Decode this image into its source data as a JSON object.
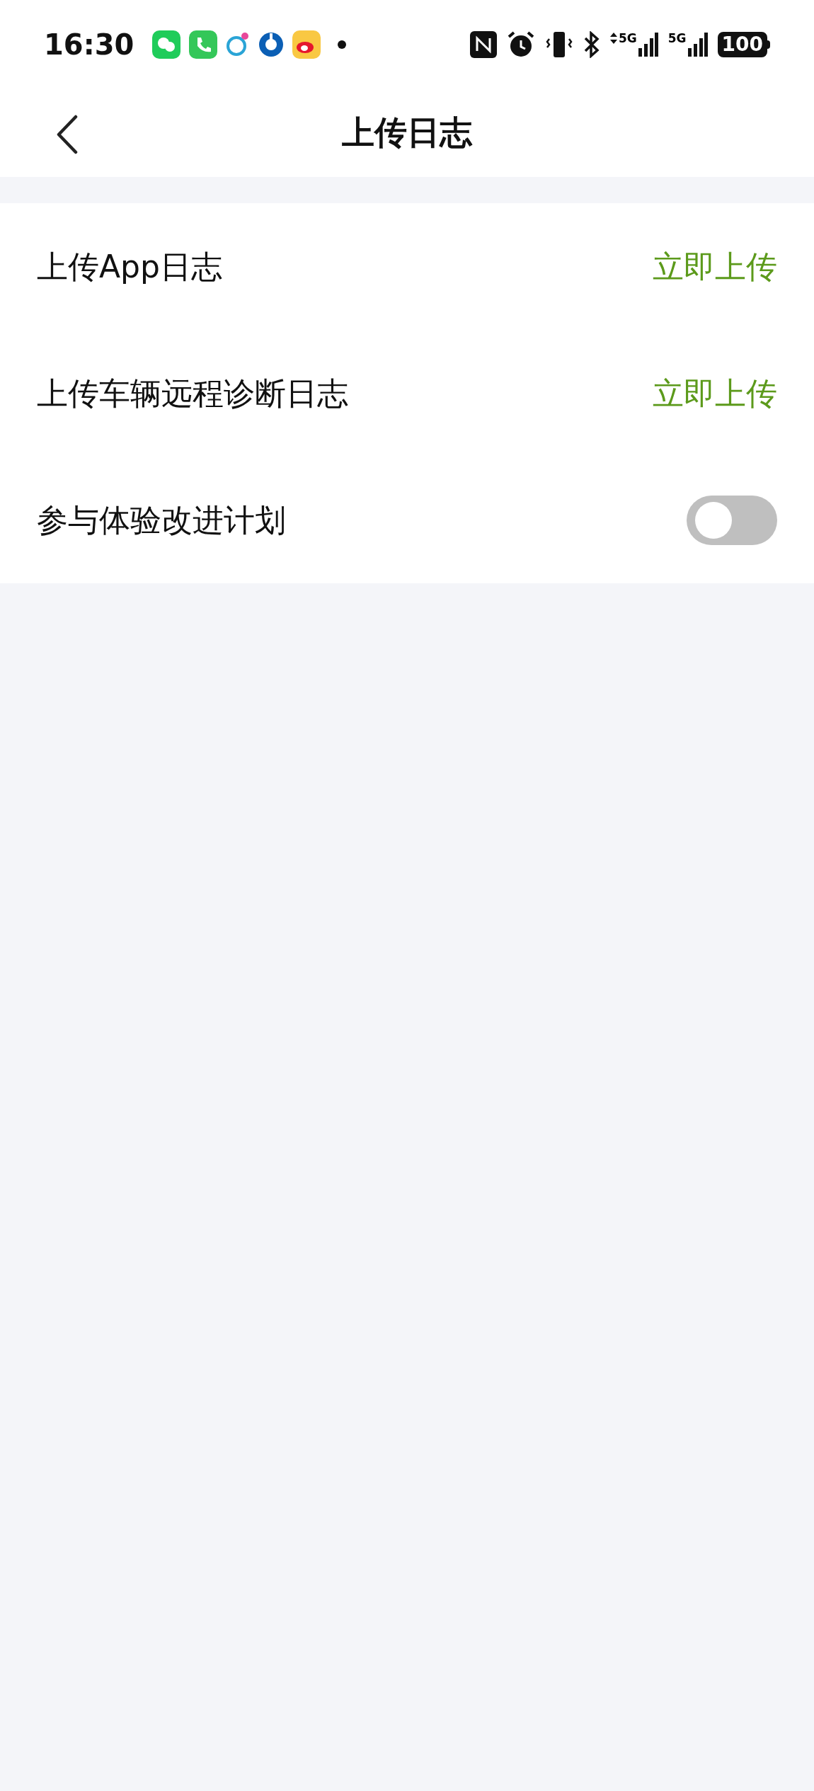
{
  "status_bar": {
    "time": "16:30",
    "network_1": "5G",
    "network_2": "5G",
    "battery": "100"
  },
  "header": {
    "title": "上传日志"
  },
  "rows": [
    {
      "kind": "action",
      "label": "上传App日志",
      "action": "立即上传"
    },
    {
      "kind": "action",
      "label": "上传车辆远程诊断日志",
      "action": "立即上传"
    },
    {
      "kind": "toggle",
      "label": "参与体验改进计划",
      "on": false
    }
  ]
}
